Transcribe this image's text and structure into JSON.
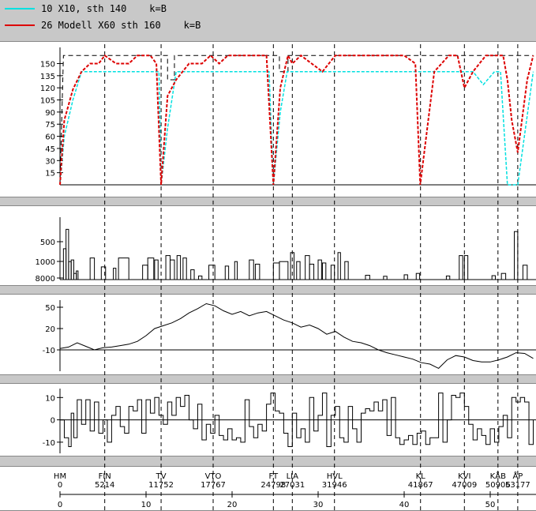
{
  "legend": [
    {
      "label": "10 X10, sth 140    k=B",
      "color": "#00e0e0"
    },
    {
      "label": "26 Modell X60 sth 160    k=B",
      "color": "#dd0000"
    }
  ],
  "chart_data": {
    "type": "line",
    "x_label_unit": "km",
    "stations": [
      {
        "code": "HM",
        "pos": "0",
        "km": 0.0
      },
      {
        "code": "FIN",
        "pos": "5214",
        "km": 5.2
      },
      {
        "code": "TV",
        "pos": "11752",
        "km": 11.75
      },
      {
        "code": "VTO",
        "pos": "17767",
        "km": 17.8
      },
      {
        "code": "FT",
        "pos": "24798",
        "km": 24.8
      },
      {
        "code": "LIA",
        "pos": "27031",
        "km": 27.0
      },
      {
        "code": "HVL",
        "pos": "31946",
        "km": 31.9
      },
      {
        "code": "KL",
        "pos": "41867",
        "km": 41.9
      },
      {
        "code": "KVI",
        "pos": "47009",
        "km": 47.0
      },
      {
        "code": "KÅB",
        "pos": "50906",
        "km": 50.9
      },
      {
        "code": "ÅP",
        "pos": "53177",
        "km": 53.2
      }
    ],
    "x_ticks": [
      0,
      10,
      20,
      30,
      40,
      50
    ],
    "xlim": [
      0,
      55
    ],
    "panels": [
      {
        "name": "speed",
        "yticks": [
          15,
          30,
          45,
          60,
          75,
          90,
          105,
          120,
          135,
          150
        ],
        "ylim": [
          0,
          170
        ],
        "series": [
          {
            "name": "10 X10, sth 140",
            "color": "#00e0e0",
            "x": [
              0,
              0.5,
              1.5,
              2.5,
              11.5,
              11.75,
              12.5,
              13.5,
              24.3,
              24.8,
              25.6,
              26.4,
              48,
              49.2,
              50.5,
              51.2,
              52.0,
              53.2,
              55
            ],
            "y": [
              0,
              60,
              105,
              140,
              140,
              0,
              70,
              140,
              140,
              0,
              90,
              140,
              140,
              124,
              140,
              140,
              0,
              0,
              140
            ]
          },
          {
            "name": "26 Modell X60 sth 160",
            "color": "#dd0000",
            "x": [
              0,
              0.5,
              1.5,
              2.5,
              3.5,
              4.5,
              5.2,
              6.5,
              8.0,
              9.0,
              10.5,
              11.2,
              11.75,
              12.5,
              13.5,
              15.0,
              16.5,
              17.5,
              18.5,
              19.5,
              24.0,
              24.8,
              25.6,
              26.5,
              27.0,
              28.0,
              30.5,
              32.0,
              32.5,
              40.0,
              41.3,
              41.867,
              43.5,
              45.2,
              46.2,
              47.0,
              48.0,
              49.5,
              50.5,
              51.5,
              52.0,
              52.5,
              53.2,
              54.3,
              55
            ],
            "y": [
              0,
              80,
              118,
              140,
              150,
              150,
              160,
              150,
              150,
              160,
              160,
              150,
              0,
              110,
              130,
              150,
              150,
              160,
              150,
              160,
              160,
              0,
              120,
              160,
              150,
              160,
              140,
              160,
              160,
              160,
              150,
              0,
              140,
              160,
              160,
              120,
              140,
              160,
              160,
              160,
              130,
              80,
              40,
              130,
              160
            ]
          }
        ]
      },
      {
        "name": "radius",
        "yticks": [
          500,
          1000,
          8000
        ],
        "bars": [
          [
            0.4,
            0.7,
            700
          ],
          [
            0.7,
            1.0,
            430
          ],
          [
            1.0,
            1.3,
            1200
          ],
          [
            1.3,
            1.6,
            1100
          ],
          [
            1.6,
            1.9,
            3500
          ],
          [
            1.9,
            2.1,
            2500
          ],
          [
            3.5,
            4.0,
            1000
          ],
          [
            4.8,
            5.3,
            1700
          ],
          [
            6.2,
            6.5,
            1900
          ],
          [
            6.8,
            8.0,
            1000
          ],
          [
            9.6,
            10.2,
            1500
          ],
          [
            10.2,
            10.9,
            1000
          ],
          [
            11.0,
            11.4,
            1100
          ],
          [
            12.3,
            12.8,
            900
          ],
          [
            12.8,
            13.3,
            1100
          ],
          [
            13.6,
            14.0,
            900
          ],
          [
            14.3,
            14.7,
            1000
          ],
          [
            15.2,
            15.6,
            2200
          ],
          [
            16.1,
            16.5,
            6000
          ],
          [
            17.3,
            18.0,
            1500
          ],
          [
            19.2,
            19.6,
            1600
          ],
          [
            20.3,
            20.6,
            1200
          ],
          [
            22.0,
            22.5,
            1100
          ],
          [
            22.7,
            23.2,
            1400
          ],
          [
            24.8,
            25.5,
            1300
          ],
          [
            25.5,
            26.5,
            1200
          ],
          [
            26.8,
            27.2,
            800
          ],
          [
            27.5,
            27.9,
            1200
          ],
          [
            28.5,
            29.0,
            900
          ],
          [
            29.0,
            29.5,
            1400
          ],
          [
            30.0,
            30.4,
            1100
          ],
          [
            30.5,
            30.9,
            1300
          ],
          [
            31.5,
            31.9,
            1500
          ],
          [
            32.3,
            32.6,
            800
          ],
          [
            33.1,
            33.5,
            1200
          ],
          [
            35.5,
            36.0,
            5000
          ],
          [
            37.6,
            38.0,
            6500
          ],
          [
            40.0,
            40.4,
            4500
          ],
          [
            41.4,
            41.8,
            3500
          ],
          [
            44.9,
            45.3,
            6000
          ],
          [
            46.4,
            46.8,
            900
          ],
          [
            47.0,
            47.4,
            900
          ],
          [
            50.2,
            50.6,
            5500
          ],
          [
            51.3,
            51.8,
            3500
          ],
          [
            52.8,
            53.2,
            450
          ],
          [
            53.8,
            54.3,
            1500
          ]
        ]
      },
      {
        "name": "height",
        "yticks": [
          50,
          20,
          -10
        ],
        "ylim": [
          -40,
          60
        ],
        "x": [
          0,
          1,
          2,
          3,
          4,
          5,
          6,
          7,
          8,
          9,
          10,
          11,
          12,
          13,
          14,
          15,
          16,
          17,
          18,
          19,
          20,
          21,
          22,
          23,
          24,
          25,
          26,
          27,
          28,
          29,
          30,
          31,
          32,
          33,
          34,
          35,
          36,
          37,
          38,
          39,
          40,
          41,
          42,
          43,
          44,
          45,
          46,
          47,
          48,
          49,
          50,
          51,
          52,
          53,
          54,
          55
        ],
        "y": [
          -8,
          -6,
          0,
          -5,
          -10,
          -7,
          -6,
          -4,
          -2,
          2,
          10,
          20,
          24,
          28,
          34,
          42,
          48,
          55,
          52,
          45,
          40,
          44,
          38,
          42,
          44,
          38,
          32,
          28,
          22,
          25,
          20,
          12,
          16,
          8,
          2,
          0,
          -4,
          -10,
          -14,
          -17,
          -20,
          -23,
          -28,
          -30,
          -36,
          -24,
          -18,
          -20,
          -25,
          -27,
          -27,
          -24,
          -20,
          -14,
          -15,
          -22
        ]
      },
      {
        "name": "gradient",
        "yticks": [
          10,
          0,
          -10
        ],
        "ylim": [
          -15,
          14
        ],
        "x": [
          0,
          0.5,
          1.0,
          1.3,
          1.6,
          2.0,
          2.5,
          3.0,
          3.5,
          4.0,
          4.5,
          5.0,
          5.5,
          6.0,
          6.5,
          7.0,
          7.5,
          8.0,
          8.5,
          9.0,
          9.5,
          10.0,
          10.5,
          11.0,
          11.5,
          12.0,
          12.5,
          13.0,
          13.5,
          14.0,
          14.5,
          15.0,
          15.5,
          16.0,
          16.5,
          17.0,
          17.5,
          18.0,
          18.5,
          19.0,
          19.5,
          20.0,
          20.5,
          21.0,
          21.5,
          22.0,
          22.5,
          23.0,
          23.5,
          24.0,
          24.5,
          25.0,
          25.5,
          26.0,
          26.5,
          27.0,
          27.5,
          28.0,
          28.5,
          29.0,
          29.5,
          30.0,
          30.5,
          31.0,
          31.5,
          32.0,
          32.5,
          33.0,
          33.5,
          34.0,
          34.5,
          35.0,
          35.5,
          36.0,
          36.5,
          37.0,
          37.5,
          38.0,
          38.5,
          39.0,
          39.5,
          40.0,
          40.5,
          41.0,
          41.5,
          42.0,
          42.5,
          43.0,
          43.5,
          44.0,
          44.5,
          45.0,
          45.5,
          46.0,
          46.5,
          47.0,
          47.5,
          48.0,
          48.5,
          49.0,
          49.5,
          50.0,
          50.5,
          51.0,
          51.5,
          52.0,
          52.5,
          53.0,
          53.5,
          54.0,
          54.5,
          55.0
        ],
        "y": [
          0,
          -8,
          -12,
          3,
          -8,
          9,
          -2,
          9,
          -5,
          8,
          -6,
          0,
          -10,
          2,
          6,
          -3,
          -6,
          6,
          4,
          9,
          -6,
          9,
          3,
          10,
          2,
          -2,
          8,
          2,
          10,
          6,
          11,
          0,
          -4,
          7,
          -9,
          -2,
          -6,
          2,
          -7,
          -9,
          -4,
          -9,
          -8,
          -10,
          9,
          -3,
          -8,
          -2,
          -5,
          7,
          12,
          4,
          3,
          -6,
          -12,
          3,
          -8,
          -4,
          -10,
          10,
          -5,
          2,
          12,
          -12,
          2,
          6,
          -8,
          -10,
          6,
          -4,
          -10,
          3,
          5,
          4,
          8,
          4,
          9,
          -7,
          10,
          -8,
          -11,
          -9,
          -7,
          -11,
          -6,
          -5,
          -11,
          -8,
          -8,
          12,
          -10,
          0,
          11,
          10,
          12,
          6,
          -2,
          -9,
          -4,
          -7,
          -11,
          -4,
          -10,
          -3,
          2,
          -8,
          10,
          8,
          10,
          8,
          -11,
          0
        ]
      }
    ]
  }
}
